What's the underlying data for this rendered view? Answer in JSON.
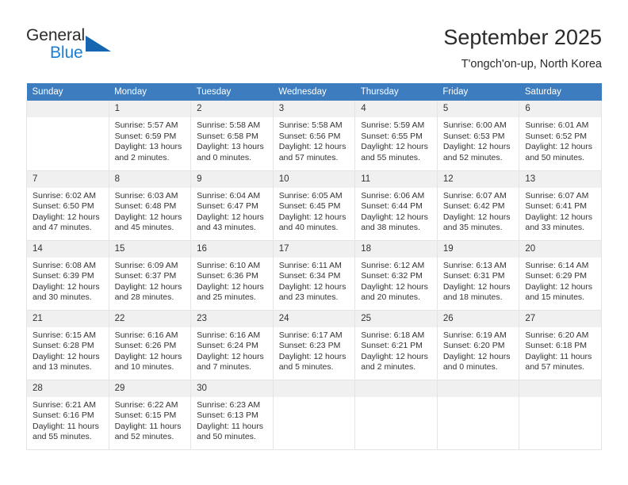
{
  "logo": {
    "word_top": "General",
    "word_bottom": "Blue",
    "triangle_color": "#1565b0",
    "blue_text_color": "#1a7fd4"
  },
  "header": {
    "title": "September 2025",
    "subtitle": "T'ongch'on-up, North Korea"
  },
  "theme": {
    "header_row_bg": "#3c7cbf",
    "daynum_bg": "#f0f0f0",
    "cell_border": "#e4e4e4",
    "text": "#333333"
  },
  "labels": {
    "sunrise_prefix": "Sunrise:",
    "sunset_prefix": "Sunset:",
    "daylight_prefix": "Daylight:"
  },
  "weekday_headers": [
    "Sunday",
    "Monday",
    "Tuesday",
    "Wednesday",
    "Thursday",
    "Friday",
    "Saturday"
  ],
  "weeks": [
    [
      {
        "day": "",
        "sunrise": "",
        "sunset": "",
        "daylight_line1": "",
        "daylight_line2": ""
      },
      {
        "day": "1",
        "sunrise": "Sunrise: 5:57 AM",
        "sunset": "Sunset: 6:59 PM",
        "daylight_line1": "Daylight: 13 hours",
        "daylight_line2": "and 2 minutes."
      },
      {
        "day": "2",
        "sunrise": "Sunrise: 5:58 AM",
        "sunset": "Sunset: 6:58 PM",
        "daylight_line1": "Daylight: 13 hours",
        "daylight_line2": "and 0 minutes."
      },
      {
        "day": "3",
        "sunrise": "Sunrise: 5:58 AM",
        "sunset": "Sunset: 6:56 PM",
        "daylight_line1": "Daylight: 12 hours",
        "daylight_line2": "and 57 minutes."
      },
      {
        "day": "4",
        "sunrise": "Sunrise: 5:59 AM",
        "sunset": "Sunset: 6:55 PM",
        "daylight_line1": "Daylight: 12 hours",
        "daylight_line2": "and 55 minutes."
      },
      {
        "day": "5",
        "sunrise": "Sunrise: 6:00 AM",
        "sunset": "Sunset: 6:53 PM",
        "daylight_line1": "Daylight: 12 hours",
        "daylight_line2": "and 52 minutes."
      },
      {
        "day": "6",
        "sunrise": "Sunrise: 6:01 AM",
        "sunset": "Sunset: 6:52 PM",
        "daylight_line1": "Daylight: 12 hours",
        "daylight_line2": "and 50 minutes."
      }
    ],
    [
      {
        "day": "7",
        "sunrise": "Sunrise: 6:02 AM",
        "sunset": "Sunset: 6:50 PM",
        "daylight_line1": "Daylight: 12 hours",
        "daylight_line2": "and 47 minutes."
      },
      {
        "day": "8",
        "sunrise": "Sunrise: 6:03 AM",
        "sunset": "Sunset: 6:48 PM",
        "daylight_line1": "Daylight: 12 hours",
        "daylight_line2": "and 45 minutes."
      },
      {
        "day": "9",
        "sunrise": "Sunrise: 6:04 AM",
        "sunset": "Sunset: 6:47 PM",
        "daylight_line1": "Daylight: 12 hours",
        "daylight_line2": "and 43 minutes."
      },
      {
        "day": "10",
        "sunrise": "Sunrise: 6:05 AM",
        "sunset": "Sunset: 6:45 PM",
        "daylight_line1": "Daylight: 12 hours",
        "daylight_line2": "and 40 minutes."
      },
      {
        "day": "11",
        "sunrise": "Sunrise: 6:06 AM",
        "sunset": "Sunset: 6:44 PM",
        "daylight_line1": "Daylight: 12 hours",
        "daylight_line2": "and 38 minutes."
      },
      {
        "day": "12",
        "sunrise": "Sunrise: 6:07 AM",
        "sunset": "Sunset: 6:42 PM",
        "daylight_line1": "Daylight: 12 hours",
        "daylight_line2": "and 35 minutes."
      },
      {
        "day": "13",
        "sunrise": "Sunrise: 6:07 AM",
        "sunset": "Sunset: 6:41 PM",
        "daylight_line1": "Daylight: 12 hours",
        "daylight_line2": "and 33 minutes."
      }
    ],
    [
      {
        "day": "14",
        "sunrise": "Sunrise: 6:08 AM",
        "sunset": "Sunset: 6:39 PM",
        "daylight_line1": "Daylight: 12 hours",
        "daylight_line2": "and 30 minutes."
      },
      {
        "day": "15",
        "sunrise": "Sunrise: 6:09 AM",
        "sunset": "Sunset: 6:37 PM",
        "daylight_line1": "Daylight: 12 hours",
        "daylight_line2": "and 28 minutes."
      },
      {
        "day": "16",
        "sunrise": "Sunrise: 6:10 AM",
        "sunset": "Sunset: 6:36 PM",
        "daylight_line1": "Daylight: 12 hours",
        "daylight_line2": "and 25 minutes."
      },
      {
        "day": "17",
        "sunrise": "Sunrise: 6:11 AM",
        "sunset": "Sunset: 6:34 PM",
        "daylight_line1": "Daylight: 12 hours",
        "daylight_line2": "and 23 minutes."
      },
      {
        "day": "18",
        "sunrise": "Sunrise: 6:12 AM",
        "sunset": "Sunset: 6:32 PM",
        "daylight_line1": "Daylight: 12 hours",
        "daylight_line2": "and 20 minutes."
      },
      {
        "day": "19",
        "sunrise": "Sunrise: 6:13 AM",
        "sunset": "Sunset: 6:31 PM",
        "daylight_line1": "Daylight: 12 hours",
        "daylight_line2": "and 18 minutes."
      },
      {
        "day": "20",
        "sunrise": "Sunrise: 6:14 AM",
        "sunset": "Sunset: 6:29 PM",
        "daylight_line1": "Daylight: 12 hours",
        "daylight_line2": "and 15 minutes."
      }
    ],
    [
      {
        "day": "21",
        "sunrise": "Sunrise: 6:15 AM",
        "sunset": "Sunset: 6:28 PM",
        "daylight_line1": "Daylight: 12 hours",
        "daylight_line2": "and 13 minutes."
      },
      {
        "day": "22",
        "sunrise": "Sunrise: 6:16 AM",
        "sunset": "Sunset: 6:26 PM",
        "daylight_line1": "Daylight: 12 hours",
        "daylight_line2": "and 10 minutes."
      },
      {
        "day": "23",
        "sunrise": "Sunrise: 6:16 AM",
        "sunset": "Sunset: 6:24 PM",
        "daylight_line1": "Daylight: 12 hours",
        "daylight_line2": "and 7 minutes."
      },
      {
        "day": "24",
        "sunrise": "Sunrise: 6:17 AM",
        "sunset": "Sunset: 6:23 PM",
        "daylight_line1": "Daylight: 12 hours",
        "daylight_line2": "and 5 minutes."
      },
      {
        "day": "25",
        "sunrise": "Sunrise: 6:18 AM",
        "sunset": "Sunset: 6:21 PM",
        "daylight_line1": "Daylight: 12 hours",
        "daylight_line2": "and 2 minutes."
      },
      {
        "day": "26",
        "sunrise": "Sunrise: 6:19 AM",
        "sunset": "Sunset: 6:20 PM",
        "daylight_line1": "Daylight: 12 hours",
        "daylight_line2": "and 0 minutes."
      },
      {
        "day": "27",
        "sunrise": "Sunrise: 6:20 AM",
        "sunset": "Sunset: 6:18 PM",
        "daylight_line1": "Daylight: 11 hours",
        "daylight_line2": "and 57 minutes."
      }
    ],
    [
      {
        "day": "28",
        "sunrise": "Sunrise: 6:21 AM",
        "sunset": "Sunset: 6:16 PM",
        "daylight_line1": "Daylight: 11 hours",
        "daylight_line2": "and 55 minutes."
      },
      {
        "day": "29",
        "sunrise": "Sunrise: 6:22 AM",
        "sunset": "Sunset: 6:15 PM",
        "daylight_line1": "Daylight: 11 hours",
        "daylight_line2": "and 52 minutes."
      },
      {
        "day": "30",
        "sunrise": "Sunrise: 6:23 AM",
        "sunset": "Sunset: 6:13 PM",
        "daylight_line1": "Daylight: 11 hours",
        "daylight_line2": "and 50 minutes."
      },
      {
        "day": "",
        "sunrise": "",
        "sunset": "",
        "daylight_line1": "",
        "daylight_line2": ""
      },
      {
        "day": "",
        "sunrise": "",
        "sunset": "",
        "daylight_line1": "",
        "daylight_line2": ""
      },
      {
        "day": "",
        "sunrise": "",
        "sunset": "",
        "daylight_line1": "",
        "daylight_line2": ""
      },
      {
        "day": "",
        "sunrise": "",
        "sunset": "",
        "daylight_line1": "",
        "daylight_line2": ""
      }
    ]
  ]
}
